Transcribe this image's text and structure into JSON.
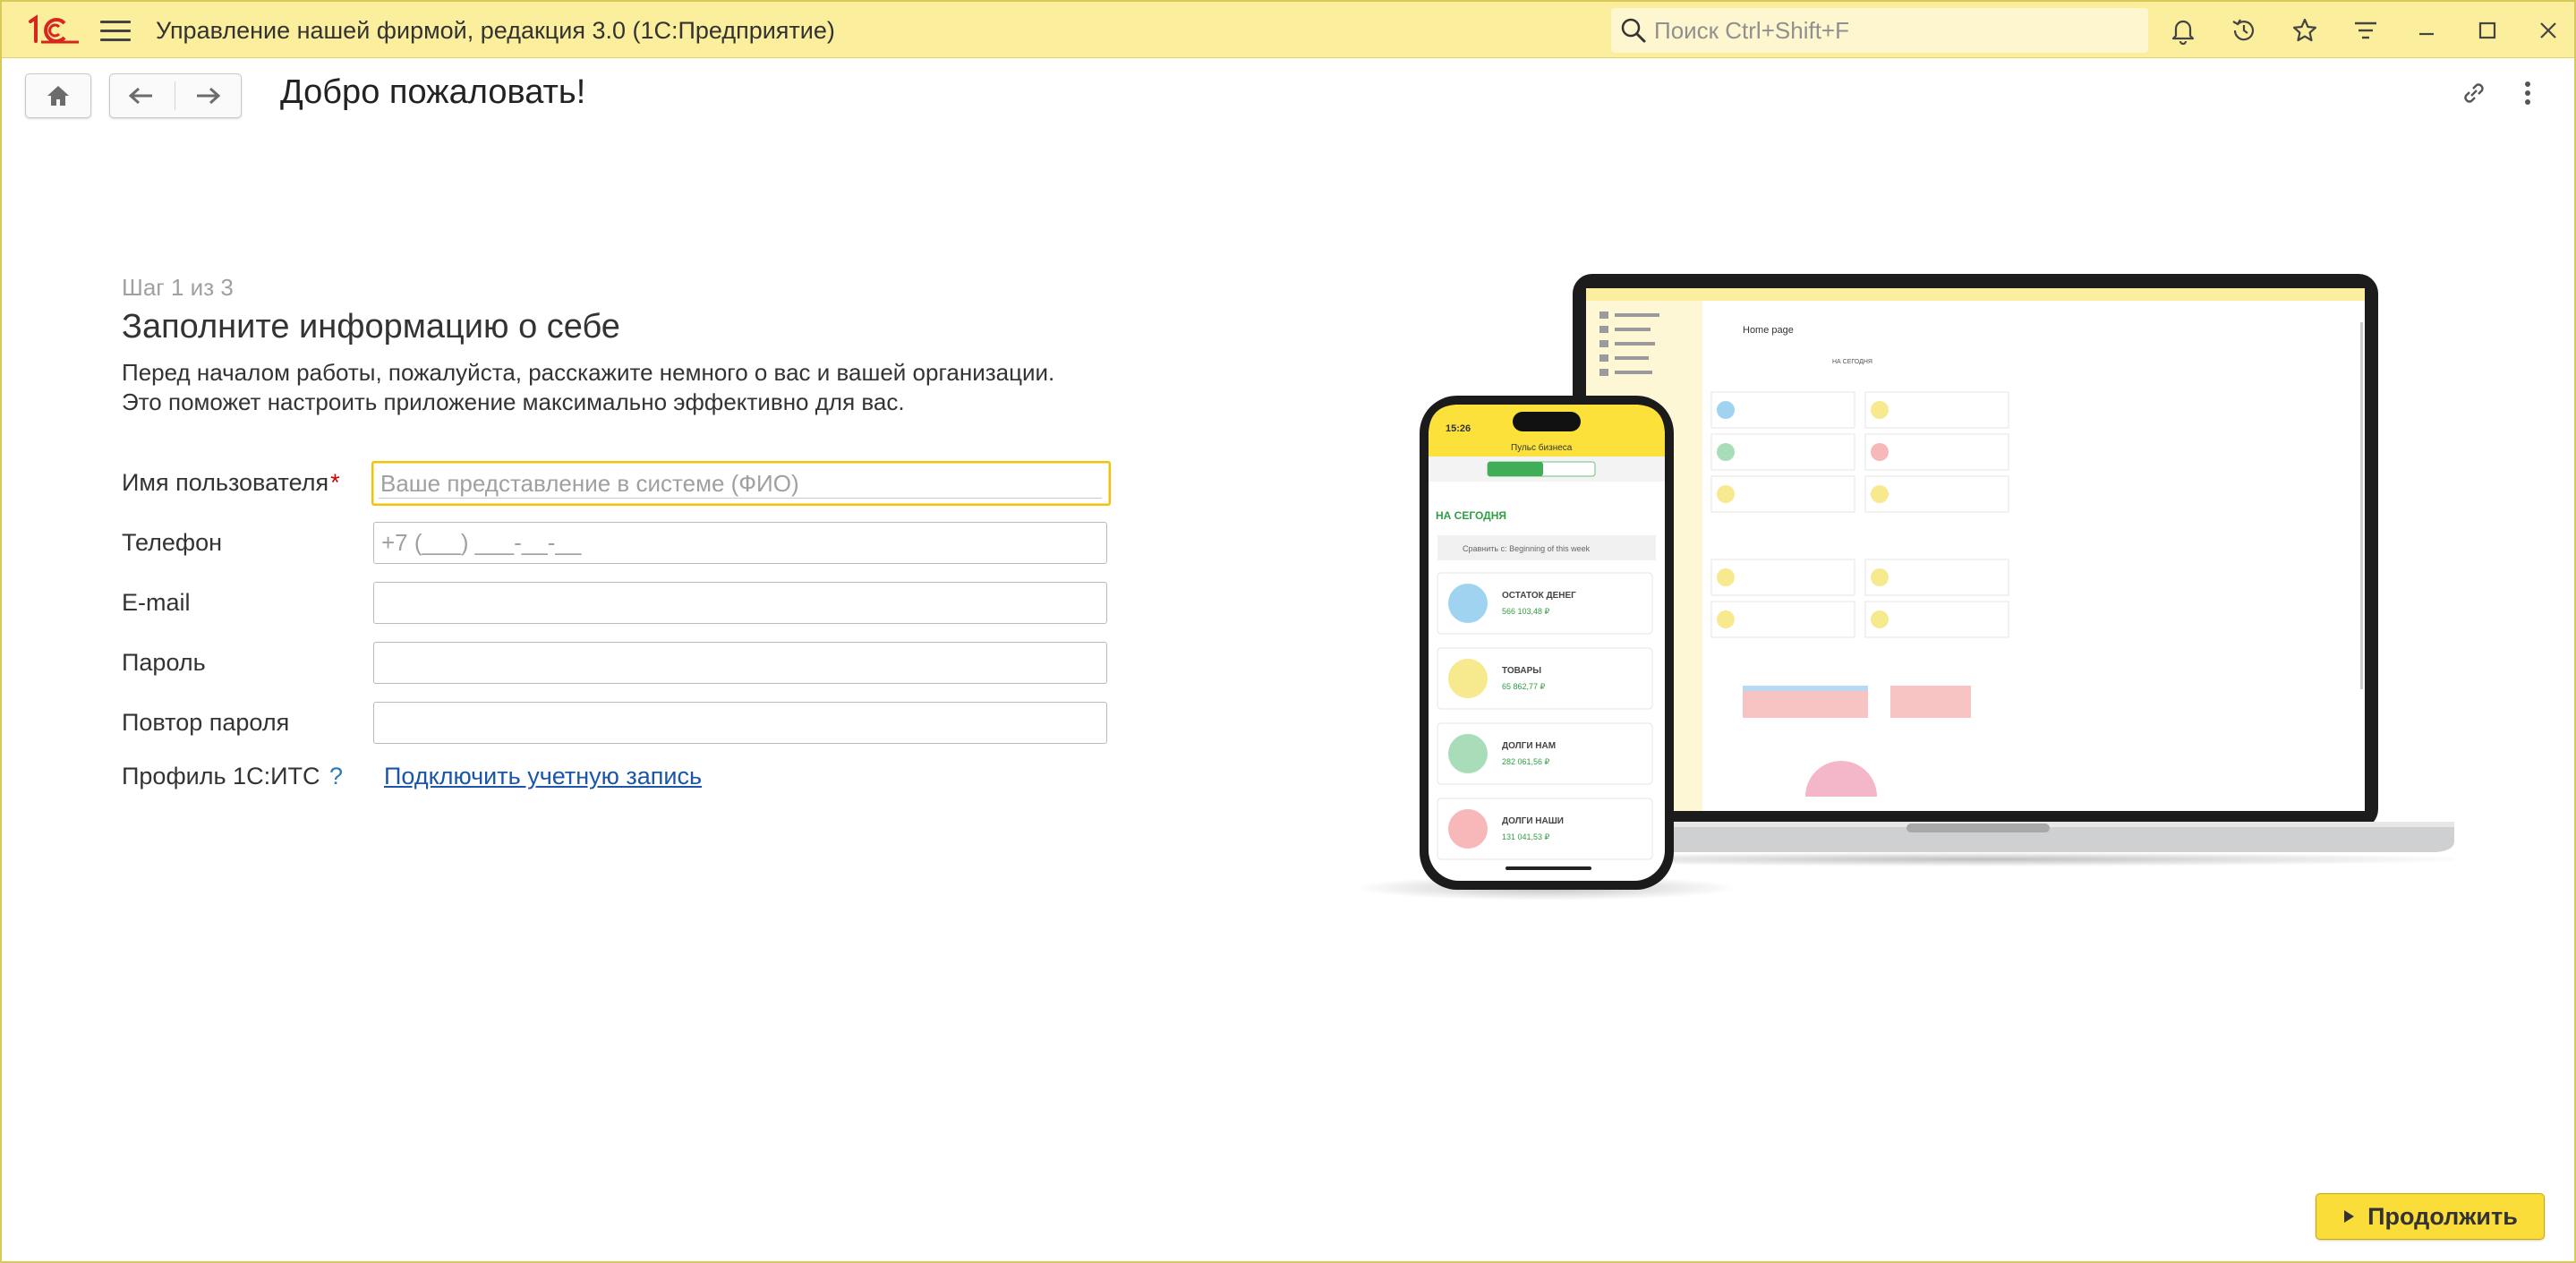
{
  "titlebar": {
    "app_title": "Управление нашей фирмой, редакция 3.0  (1С:Предприятие)",
    "search_placeholder": "Поиск Ctrl+Shift+F"
  },
  "page": {
    "title": "Добро пожаловать!"
  },
  "form": {
    "step": "Шаг 1 из 3",
    "heading": "Заполните информацию о себе",
    "description_line1": "Перед началом работы, пожалуйста, расскажите немного о вас и вашей организации.",
    "description_line2": "Это поможет настроить приложение максимально эффективно для вас.",
    "username_label": "Имя пользователя",
    "username_required": "*",
    "username_placeholder": "Ваше представление в системе (ФИО)",
    "phone_label": "Телефон",
    "phone_placeholder": "+7 (___) ___-__-__",
    "email_label": "E-mail",
    "password_label": "Пароль",
    "password_repeat_label": "Повтор пароля",
    "its_profile_label": "Профиль 1С:ИТС",
    "its_help": "?",
    "its_link": "Подключить учетную запись"
  },
  "illustration": {
    "phone": {
      "time": "15:26",
      "header": "Пульс бизнеса",
      "today": "НА СЕГОДНЯ",
      "compare": "Сравнить с: Beginning of this week",
      "cards": [
        {
          "title": "ОСТАТОК ДЕНЕГ",
          "value": "566 103,48 ₽",
          "color": "#9fd3ef"
        },
        {
          "title": "ТОВАРЫ",
          "value": "65 862,77 ₽",
          "color": "#f7e98e"
        },
        {
          "title": "ДОЛГИ НАМ",
          "value": "282 061,56 ₽",
          "color": "#a9dcb8"
        },
        {
          "title": "ДОЛГИ НАШИ",
          "value": "131 041,53 ₽",
          "color": "#f6b8b8"
        }
      ]
    },
    "laptop": {
      "title": "Home page",
      "today": "НА СЕГОДНЯ"
    }
  },
  "footer": {
    "continue_label": "Продолжить"
  },
  "colors": {
    "titlebar_bg": "#fbee9c",
    "accent_yellow": "#fbdd3a",
    "focus_border": "#f3c200",
    "required": "#d00000",
    "link": "#1a55a8",
    "logo_red": "#d7261e"
  }
}
